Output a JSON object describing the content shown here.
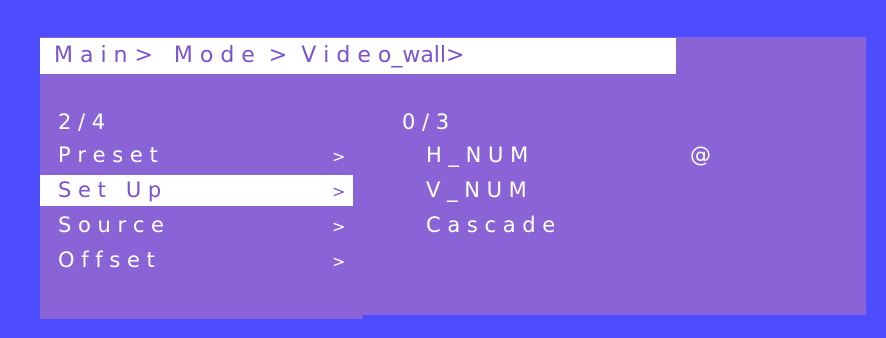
{
  "breadcrumb": "M a i n >   M o d e  >  V i d e o_wall>",
  "left_menu": {
    "page_indicator": "2 / 4",
    "items": [
      {
        "label": "P r e s e t",
        "arrow": ">",
        "selected": false
      },
      {
        "label": "S e t   U p",
        "arrow": ">",
        "selected": true
      },
      {
        "label": "S o u r c e",
        "arrow": ">",
        "selected": false
      },
      {
        "label": "O f f s e t",
        "arrow": ">",
        "selected": false
      }
    ]
  },
  "right_menu": {
    "page_indicator": "0 / 3",
    "items": [
      {
        "label": "H _ N U M",
        "marker": "@"
      },
      {
        "label": "V _ N U M",
        "marker": ""
      },
      {
        "label": "C a s c a d e",
        "marker": ""
      }
    ]
  },
  "colors": {
    "background": "#4d4dff",
    "panel": "#8a64d6",
    "highlight": "#ffffff",
    "accent_text": "#7b52d0"
  }
}
